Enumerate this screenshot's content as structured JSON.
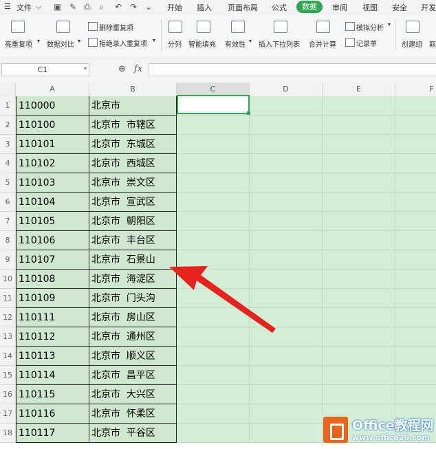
{
  "menu": {
    "file": "文件",
    "tabs": [
      "开始",
      "插入",
      "页面布局",
      "公式",
      "数据",
      "审阅",
      "视图",
      "安全",
      "开发"
    ],
    "active_tab": "数据",
    "accent": "#2fa651"
  },
  "ribbon": {
    "highlight_dup": "亮重复项",
    "compare": "数据对比",
    "delete_dup": "删除重复项",
    "reject_dup": "拒绝录入重复项",
    "split": "分列",
    "smart_fill": "智能填充",
    "validity": "有效性",
    "insert_dropdown": "插入下拉列表",
    "merge_calc": "合并计算",
    "simulate": "模拟分析",
    "record": "记录单",
    "create_group": "创建组",
    "cancel_group": "取"
  },
  "formula_bar": {
    "name_box": "C1",
    "fx_label": "fx",
    "formula": ""
  },
  "grid": {
    "columns": [
      "A",
      "B",
      "C",
      "D",
      "E",
      "F"
    ],
    "selected_column": "C",
    "rows": [
      {
        "num": "1",
        "a": "110000",
        "b": "北京市"
      },
      {
        "num": "2",
        "a": "110100",
        "b": "北京市  市辖区"
      },
      {
        "num": "3",
        "a": "110101",
        "b": "北京市  东城区"
      },
      {
        "num": "4",
        "a": "110102",
        "b": "北京市  西城区"
      },
      {
        "num": "5",
        "a": "110103",
        "b": "北京市  崇文区"
      },
      {
        "num": "6",
        "a": "110104",
        "b": "北京市  宣武区"
      },
      {
        "num": "7",
        "a": "110105",
        "b": "北京市  朝阳区"
      },
      {
        "num": "8",
        "a": "110106",
        "b": "北京市  丰台区"
      },
      {
        "num": "9",
        "a": "110107",
        "b": "北京市  石景山"
      },
      {
        "num": "10",
        "a": "110108",
        "b": "北京市  海淀区"
      },
      {
        "num": "11",
        "a": "110109",
        "b": "北京市  门头沟"
      },
      {
        "num": "12",
        "a": "110111",
        "b": "北京市  房山区"
      },
      {
        "num": "13",
        "a": "110112",
        "b": "北京市  通州区"
      },
      {
        "num": "14",
        "a": "110113",
        "b": "北京市  顺义区"
      },
      {
        "num": "15",
        "a": "110114",
        "b": "北京市  昌平区"
      },
      {
        "num": "16",
        "a": "110115",
        "b": "北京市  大兴区"
      },
      {
        "num": "17",
        "a": "110116",
        "b": "北京市  怀柔区"
      },
      {
        "num": "18",
        "a": "110117",
        "b": "北京市  平谷区"
      }
    ]
  },
  "watermark": {
    "title": "Office教程网",
    "url": "www.office26.com"
  }
}
